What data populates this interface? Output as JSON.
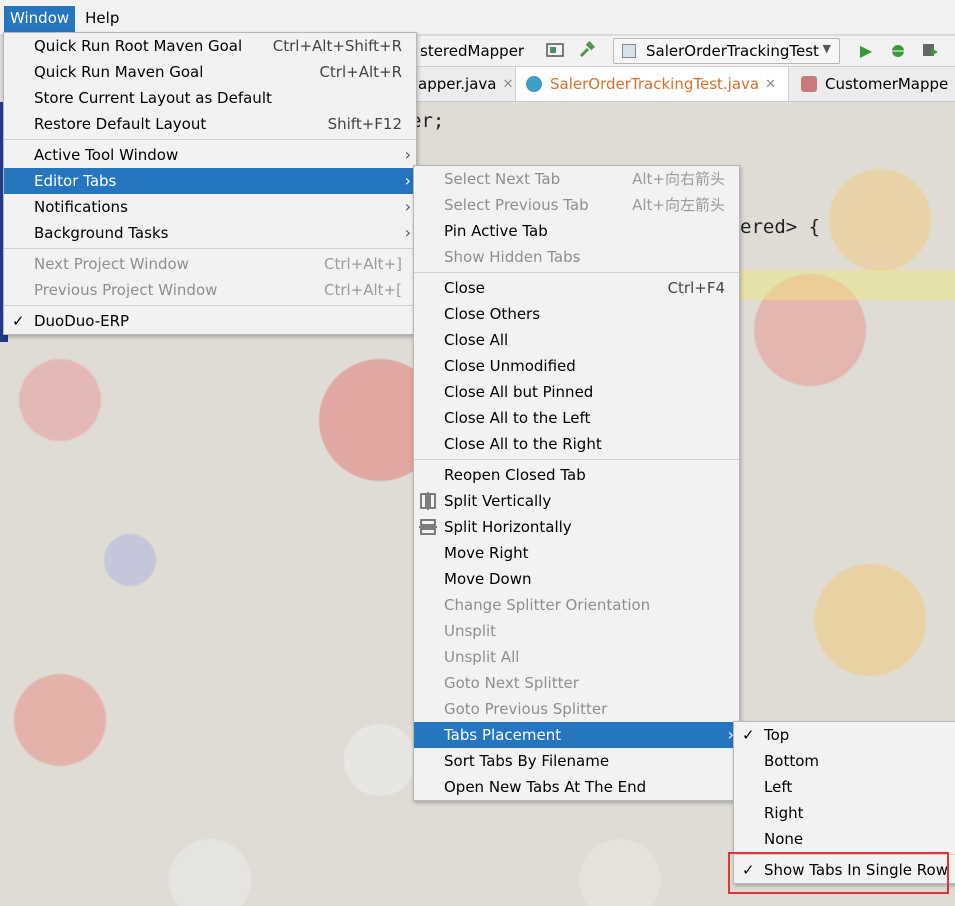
{
  "menubar": {
    "window": "Window",
    "help": "Help"
  },
  "toolbar": {
    "file_label": "steredMapper",
    "run_config": "SalerOrderTrackingTest"
  },
  "tabs": [
    {
      "label": "apper.java"
    },
    {
      "label": "SalerOrderTrackingTest.java"
    },
    {
      "label": "CustomerMappe"
    }
  ],
  "code": {
    "line1": "er;",
    "line2": "ered> {"
  },
  "window_menu": {
    "groups": [
      [
        {
          "label": "Quick Run Root Maven Goal",
          "shortcut": "Ctrl+Alt+Shift+R"
        },
        {
          "label": "Quick Run Maven Goal",
          "shortcut": "Ctrl+Alt+R"
        },
        {
          "label": "Store Current Layout as Default",
          "shortcut": ""
        },
        {
          "label": "Restore Default Layout",
          "shortcut": "Shift+F12"
        }
      ],
      [
        {
          "label": "Active Tool Window",
          "submenu": true
        },
        {
          "label": "Editor Tabs",
          "submenu": true,
          "selected": true
        },
        {
          "label": "Notifications",
          "submenu": true
        },
        {
          "label": "Background Tasks",
          "submenu": true
        }
      ],
      [
        {
          "label": "Next Project Window",
          "shortcut": "Ctrl+Alt+]",
          "disabled": true
        },
        {
          "label": "Previous Project Window",
          "shortcut": "Ctrl+Alt+[",
          "disabled": true
        }
      ],
      [
        {
          "label": "DuoDuo-ERP",
          "checked": true
        }
      ]
    ]
  },
  "editor_tabs_menu": {
    "groups": [
      [
        {
          "label": "Select Next Tab",
          "shortcut": "Alt+向右箭头",
          "disabled": true
        },
        {
          "label": "Select Previous Tab",
          "shortcut": "Alt+向左箭头",
          "disabled": true
        },
        {
          "label": "Pin Active Tab"
        },
        {
          "label": "Show Hidden Tabs",
          "disabled": true
        }
      ],
      [
        {
          "label": "Close",
          "shortcut": "Ctrl+F4"
        },
        {
          "label": "Close Others"
        },
        {
          "label": "Close All"
        },
        {
          "label": "Close Unmodified"
        },
        {
          "label": "Close All but Pinned"
        },
        {
          "label": "Close All to the Left"
        },
        {
          "label": "Close All to the Right"
        }
      ],
      [
        {
          "label": "Reopen Closed Tab"
        },
        {
          "label": "Split Vertically",
          "icon": "split-vertical-icon"
        },
        {
          "label": "Split Horizontally",
          "icon": "split-horizontal-icon"
        },
        {
          "label": "Move Right"
        },
        {
          "label": "Move Down"
        },
        {
          "label": "Change Splitter Orientation",
          "disabled": true
        },
        {
          "label": "Unsplit",
          "disabled": true
        },
        {
          "label": "Unsplit All",
          "disabled": true
        },
        {
          "label": "Goto Next Splitter",
          "disabled": true
        },
        {
          "label": "Goto Previous Splitter",
          "disabled": true
        },
        {
          "label": "Tabs Placement",
          "submenu": true,
          "selected": true
        },
        {
          "label": "Sort Tabs By Filename"
        },
        {
          "label": "Open New Tabs At The End"
        }
      ]
    ]
  },
  "tabs_placement_menu": {
    "groups": [
      [
        {
          "label": "Top",
          "checked": true
        },
        {
          "label": "Bottom"
        },
        {
          "label": "Left"
        },
        {
          "label": "Right"
        },
        {
          "label": "None"
        }
      ],
      [
        {
          "label": "Show Tabs In Single Row",
          "checked": true
        }
      ]
    ]
  },
  "colors": {
    "selection": "#2675bf",
    "highlight_box": "#e03535",
    "menu_bg": "#f2f2f2"
  }
}
